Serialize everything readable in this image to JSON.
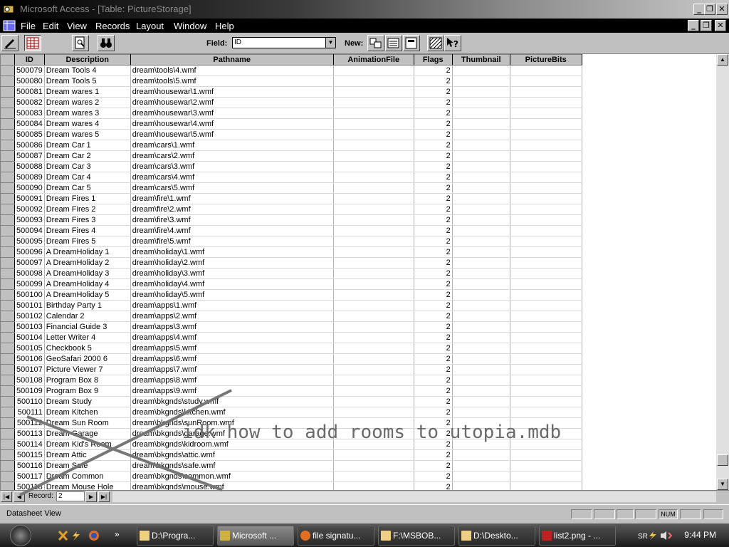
{
  "window": {
    "title": "Microsoft Access - [Table: PictureStorage]"
  },
  "menu": [
    "File",
    "Edit",
    "View",
    "Records",
    "Layout",
    "Window",
    "Help"
  ],
  "toolbar": {
    "field_label": "Field:",
    "field_value": "ID",
    "new_label": "New:"
  },
  "columns": [
    "ID",
    "Description",
    "Pathname",
    "AnimationFile",
    "Flags",
    "Thumbnail",
    "PictureBits"
  ],
  "rows": [
    [
      "500079",
      "Dream Tools 4",
      "dream\\tools\\4.wmf",
      "",
      "2",
      "",
      ""
    ],
    [
      "500080",
      "Dream Tools 5",
      "dream\\tools\\5.wmf",
      "",
      "2",
      "",
      ""
    ],
    [
      "500081",
      "Dream wares 1",
      "dream\\housewar\\1.wmf",
      "",
      "2",
      "",
      ""
    ],
    [
      "500082",
      "Dream wares 2",
      "dream\\housewar\\2.wmf",
      "",
      "2",
      "",
      ""
    ],
    [
      "500083",
      "Dream wares 3",
      "dream\\housewar\\3.wmf",
      "",
      "2",
      "",
      ""
    ],
    [
      "500084",
      "Dream wares 4",
      "dream\\housewar\\4.wmf",
      "",
      "2",
      "",
      ""
    ],
    [
      "500085",
      "Dream wares 5",
      "dream\\housewar\\5.wmf",
      "",
      "2",
      "",
      ""
    ],
    [
      "500086",
      "Dream Car 1",
      "dream\\cars\\1.wmf",
      "",
      "2",
      "",
      ""
    ],
    [
      "500087",
      "Dream Car 2",
      "dream\\cars\\2.wmf",
      "",
      "2",
      "",
      ""
    ],
    [
      "500088",
      "Dream Car 3",
      "dream\\cars\\3.wmf",
      "",
      "2",
      "",
      ""
    ],
    [
      "500089",
      "Dream Car 4",
      "dream\\cars\\4.wmf",
      "",
      "2",
      "",
      ""
    ],
    [
      "500090",
      "Dream Car 5",
      "dream\\cars\\5.wmf",
      "",
      "2",
      "",
      ""
    ],
    [
      "500091",
      "Dream Fires 1",
      "dream\\fire\\1.wmf",
      "",
      "2",
      "",
      ""
    ],
    [
      "500092",
      "Dream Fires 2",
      "dream\\fire\\2.wmf",
      "",
      "2",
      "",
      ""
    ],
    [
      "500093",
      "Dream Fires 3",
      "dream\\fire\\3.wmf",
      "",
      "2",
      "",
      ""
    ],
    [
      "500094",
      "Dream Fires 4",
      "dream\\fire\\4.wmf",
      "",
      "2",
      "",
      ""
    ],
    [
      "500095",
      "Dream Fires 5",
      "dream\\fire\\5.wmf",
      "",
      "2",
      "",
      ""
    ],
    [
      "500096",
      "A DreamHoliday 1",
      "dream\\holiday\\1.wmf",
      "",
      "2",
      "",
      ""
    ],
    [
      "500097",
      "A DreamHoliday 2",
      "dream\\holiday\\2.wmf",
      "",
      "2",
      "",
      ""
    ],
    [
      "500098",
      "A DreamHoliday 3",
      "dream\\holiday\\3.wmf",
      "",
      "2",
      "",
      ""
    ],
    [
      "500099",
      "A DreamHoliday 4",
      "dream\\holiday\\4.wmf",
      "",
      "2",
      "",
      ""
    ],
    [
      "500100",
      "A DreamHoliday 5",
      "dream\\holiday\\5.wmf",
      "",
      "2",
      "",
      ""
    ],
    [
      "500101",
      "Birthday Party 1",
      "dream\\apps\\1.wmf",
      "",
      "2",
      "",
      ""
    ],
    [
      "500102",
      "Calendar 2",
      "dream\\apps\\2.wmf",
      "",
      "2",
      "",
      ""
    ],
    [
      "500103",
      "Financial Guide 3",
      "dream\\apps\\3.wmf",
      "",
      "2",
      "",
      ""
    ],
    [
      "500104",
      "Letter Writer 4",
      "dream\\apps\\4.wmf",
      "",
      "2",
      "",
      ""
    ],
    [
      "500105",
      "Checkbook 5",
      "dream\\apps\\5.wmf",
      "",
      "2",
      "",
      ""
    ],
    [
      "500106",
      "GeoSafari 2000 6",
      "dream\\apps\\6.wmf",
      "",
      "2",
      "",
      ""
    ],
    [
      "500107",
      "Picture Viewer 7",
      "dream\\apps\\7.wmf",
      "",
      "2",
      "",
      ""
    ],
    [
      "500108",
      "Program Box 8",
      "dream\\apps\\8.wmf",
      "",
      "2",
      "",
      ""
    ],
    [
      "500109",
      "Program Box 9",
      "dream\\apps\\9.wmf",
      "",
      "2",
      "",
      ""
    ],
    [
      "500110",
      "Dream Study",
      "dream\\bkgnds\\study.wmf",
      "",
      "2",
      "",
      ""
    ],
    [
      "500111",
      "Dream Kitchen",
      "dream\\bkgnds\\kitchen.wmf",
      "",
      "2",
      "",
      ""
    ],
    [
      "500112",
      "Dream Sun Room",
      "dream\\bkgnds\\sunRoom.wmf",
      "",
      "2",
      "",
      ""
    ],
    [
      "500113",
      "Dream Garage",
      "dream\\bkgnds\\garage.wmf",
      "",
      "2",
      "",
      ""
    ],
    [
      "500114",
      "Dream Kid's Room",
      "dream\\bkgnds\\kidroom.wmf",
      "",
      "2",
      "",
      ""
    ],
    [
      "500115",
      "Dream Attic",
      "dream\\bkgnds\\attic.wmf",
      "",
      "2",
      "",
      ""
    ],
    [
      "500116",
      "Dream Safe",
      "dream\\bkgnds\\safe.wmf",
      "",
      "2",
      "",
      ""
    ],
    [
      "500117",
      "Dream Common",
      "dream\\bkgnds\\common.wmf",
      "",
      "2",
      "",
      ""
    ],
    [
      "500118",
      "Dream Mouse Hole",
      "dream\\bkgnds\\mouse.wmf",
      "",
      "2",
      "",
      ""
    ]
  ],
  "nav": {
    "record_label": "Record:",
    "record_value": "2"
  },
  "status": {
    "text": "Datasheet View",
    "indicators": [
      "",
      "",
      "",
      "",
      "NUM",
      "",
      ""
    ]
  },
  "taskbar": {
    "tasks": [
      {
        "label": "D:\\Progra...",
        "icon": "folder-icon",
        "active": false
      },
      {
        "label": "Microsoft ...",
        "icon": "access-icon",
        "active": true
      },
      {
        "label": "file signatu...",
        "icon": "firefox-icon",
        "active": false
      },
      {
        "label": "F:\\MSBOB...",
        "icon": "folder-icon",
        "active": false
      },
      {
        "label": "D:\\Deskto...",
        "icon": "folder-icon",
        "active": false
      },
      {
        "label": "list2.png - ...",
        "icon": "paint-icon",
        "active": false
      }
    ],
    "clock": "9:44 PM"
  },
  "annotation": "idk how to add rooms to utopia.mdb"
}
